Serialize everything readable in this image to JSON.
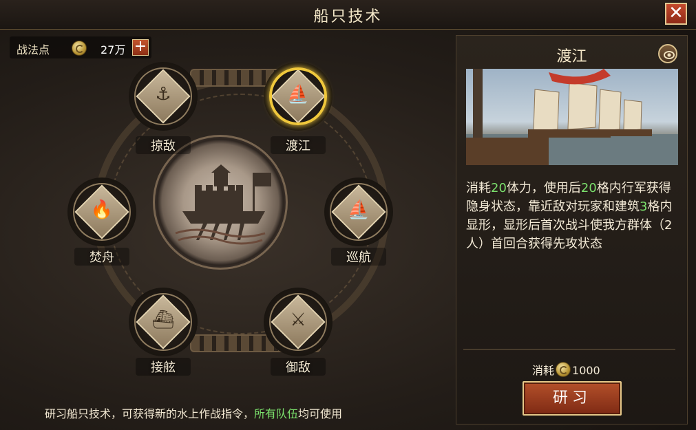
{
  "window": {
    "title": "船只技术",
    "close_icon": "close-icon"
  },
  "points": {
    "label": "战法点",
    "value": "27万",
    "add_label": "+"
  },
  "skills": [
    {
      "label": "掠敌",
      "icon": "chain-anchor-icon"
    },
    {
      "label": "渡江",
      "icon": "junk-ship-icon",
      "selected": true
    },
    {
      "label": "焚舟",
      "icon": "burning-ship-icon"
    },
    {
      "label": "巡航",
      "icon": "sailing-ship-icon"
    },
    {
      "label": "接舷",
      "icon": "boarding-ship-icon"
    },
    {
      "label": "御敌",
      "icon": "armored-soldier-icon"
    }
  ],
  "center_icon": "warship-icon",
  "footer": {
    "text_before": "研习船只技术，可获得新的水上作战指令，",
    "highlight": "所有队伍",
    "text_after": "均可使用"
  },
  "detail": {
    "title": "渡江",
    "eye_icon": "eye-icon",
    "desc": [
      {
        "t": "消耗",
        "g": false
      },
      {
        "t": "20",
        "g": true
      },
      {
        "t": "体力，使用后",
        "g": false
      },
      {
        "t": "20",
        "g": true
      },
      {
        "t": "格内行军获得隐身状态，靠近敌对玩家和建筑",
        "g": false
      },
      {
        "t": "3",
        "g": true
      },
      {
        "t": "格内显形，显形后首次战斗使我方群体（2人）首回合获得先攻状态",
        "g": false
      }
    ],
    "cost_label": "消耗",
    "cost_value": "1000",
    "research_label": "研习"
  },
  "colors": {
    "accent_green": "#7be06c",
    "selected_ring": "#f0c83c",
    "button_red": "#9a3a1e"
  }
}
